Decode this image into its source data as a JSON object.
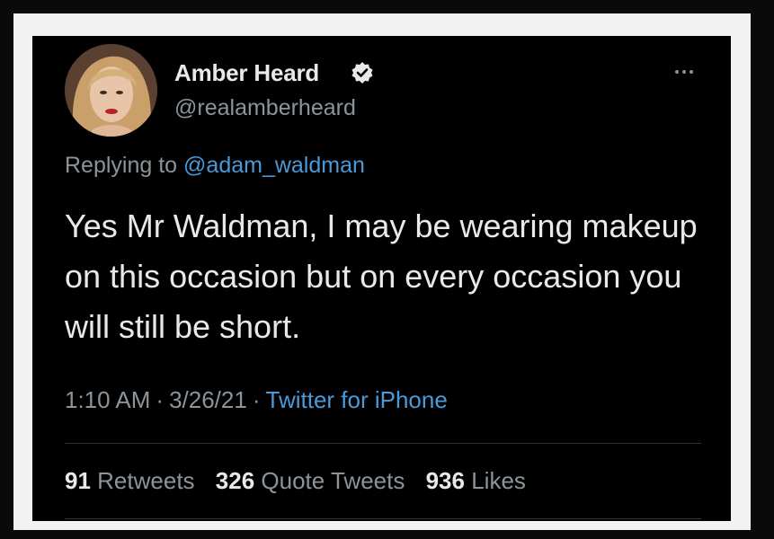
{
  "user": {
    "display_name": "Amber Heard",
    "handle": "@realamberheard",
    "verified_icon": "verified-badge-icon"
  },
  "reply": {
    "prefix": "Replying to",
    "mention": "@adam_waldman"
  },
  "tweet": {
    "text": "Yes Mr Waldman, I may be wearing makeup on this occasion but on every occasion you will still be short.",
    "time": "1:10 AM",
    "date": "3/26/21",
    "separator": "·",
    "source": "Twitter for iPhone"
  },
  "stats": {
    "retweets_count": "91",
    "retweets_label": "Retweets",
    "quotes_count": "326",
    "quotes_label": "Quote Tweets",
    "likes_count": "936",
    "likes_label": "Likes"
  },
  "colors": {
    "background": "#000000",
    "text_primary": "#e7e9ea",
    "text_secondary": "#8b949b",
    "link": "#4a9ad9",
    "frame": "#f2f2f2"
  }
}
